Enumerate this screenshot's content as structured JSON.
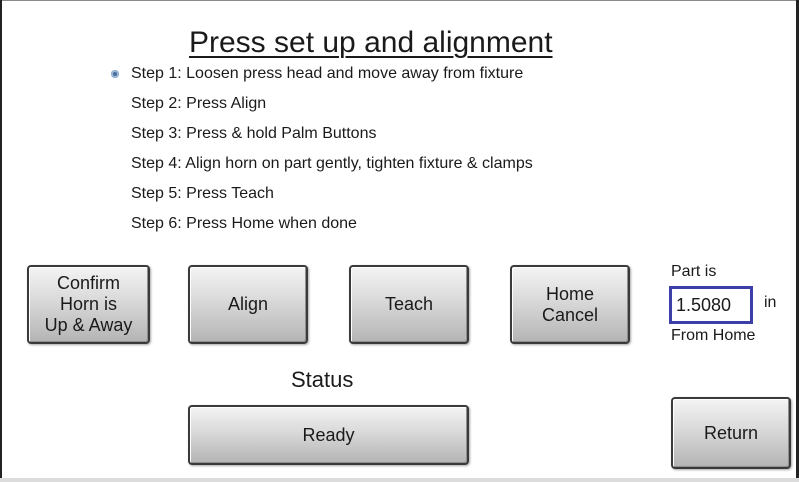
{
  "title": "Press set up and alignment",
  "steps": [
    "Step 1: Loosen press head and move away from fixture",
    "Step 2: Press Align",
    "Step 3: Press & hold Palm Buttons",
    "Step 4: Align horn on part gently, tighten fixture & clamps",
    "Step 5: Press Teach",
    "Step 6: Press Home when done"
  ],
  "buttons": {
    "confirm": [
      "Confirm",
      "Horn is",
      "Up & Away"
    ],
    "align": "Align",
    "teach": "Teach",
    "home_cancel": [
      "Home",
      "Cancel"
    ],
    "ready": "Ready",
    "return": "Return"
  },
  "position": {
    "label": "Part is",
    "value": "1.5080",
    "unit": "in",
    "suffix": "From Home"
  },
  "status": {
    "label": "Status"
  },
  "colors": {
    "bullet": "#4a6f9c",
    "field_border": "#3b3fa6"
  }
}
